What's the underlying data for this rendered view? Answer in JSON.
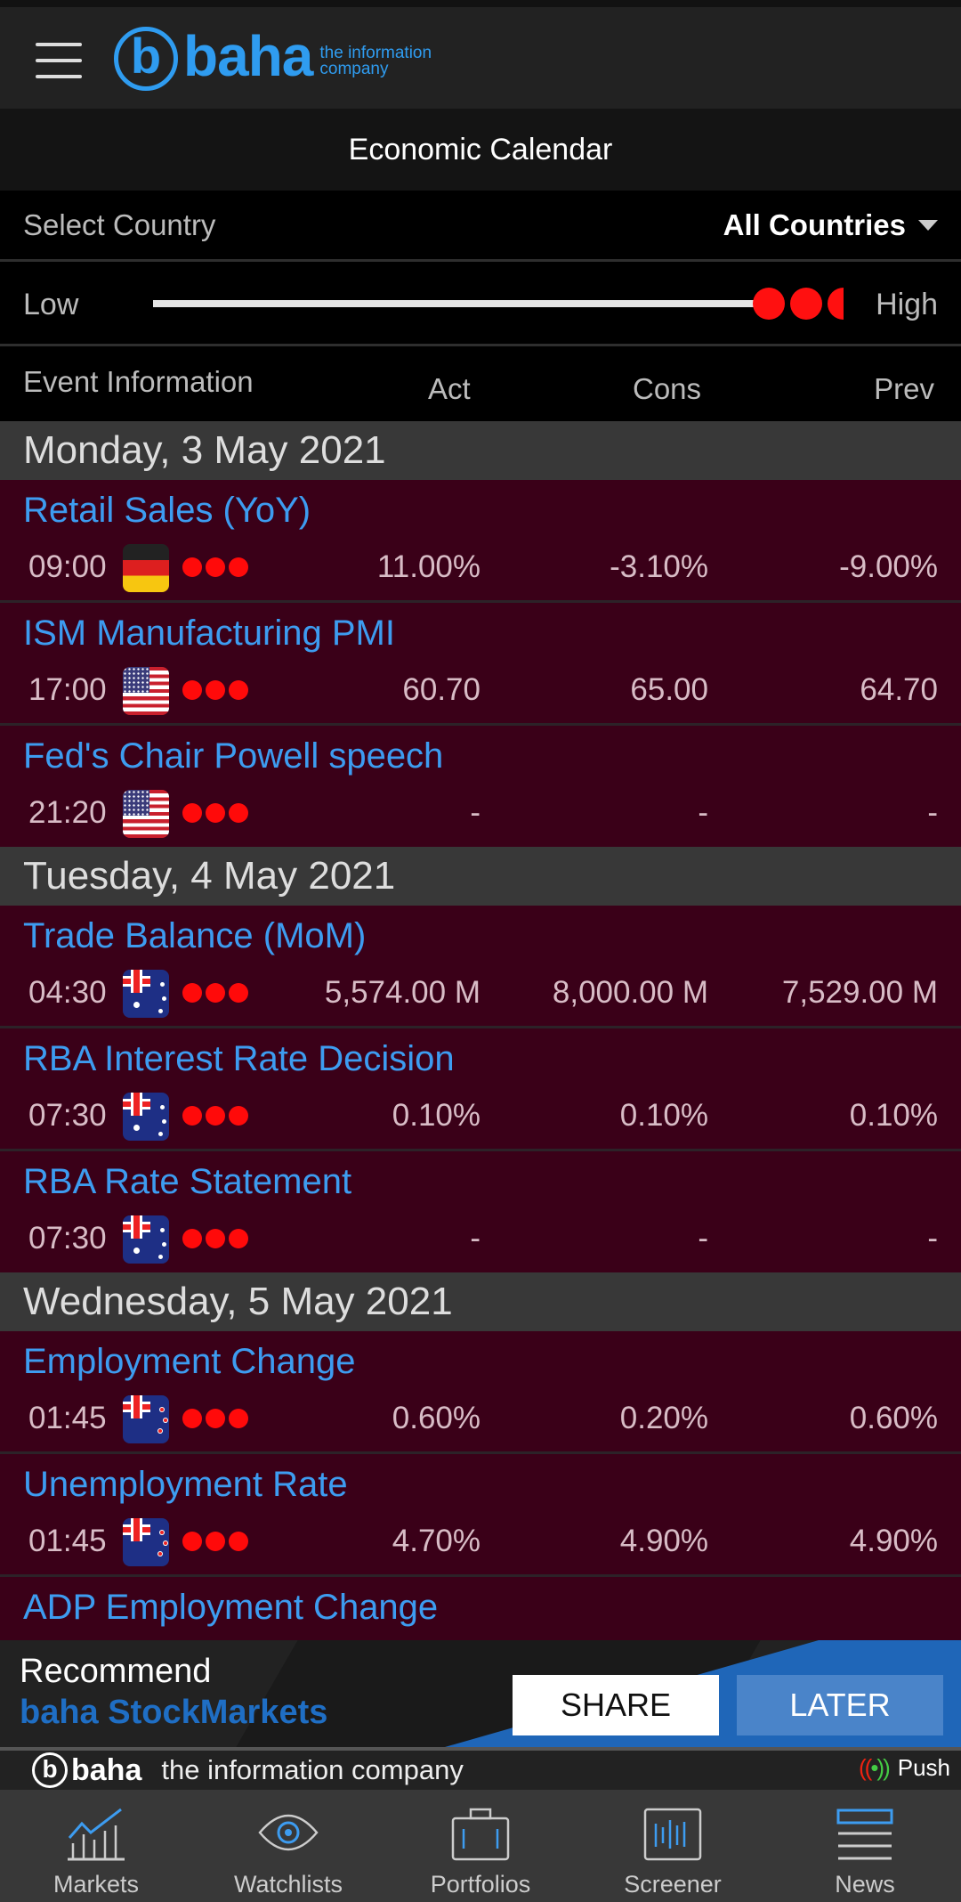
{
  "app": {
    "brand": "baha",
    "tagline_line1": "the information",
    "tagline_line2": "company",
    "logo_letter": "b"
  },
  "page_title": "Economic Calendar",
  "country_filter": {
    "label": "Select Country",
    "selected": "All Countries"
  },
  "importance_filter": {
    "low_label": "Low",
    "high_label": "High",
    "selected_level": "High",
    "accent_color": "#ff1010"
  },
  "columns": {
    "event": "Event Information",
    "actual": "Act",
    "consensus": "Cons",
    "previous": "Prev"
  },
  "days": [
    {
      "date": "Monday, 3 May 2021",
      "events": [
        {
          "name": "Retail Sales (YoY)",
          "time": "09:00",
          "country": "Germany",
          "flag": "de",
          "importance": 3,
          "actual": "11.00%",
          "consensus": "-3.10%",
          "previous": "-9.00%"
        },
        {
          "name": "ISM Manufacturing PMI",
          "time": "17:00",
          "country": "United States",
          "flag": "us",
          "importance": 3,
          "actual": "60.70",
          "consensus": "65.00",
          "previous": "64.70"
        },
        {
          "name": "Fed's Chair Powell speech",
          "time": "21:20",
          "country": "United States",
          "flag": "us",
          "importance": 3,
          "actual": "-",
          "consensus": "-",
          "previous": "-"
        }
      ]
    },
    {
      "date": "Tuesday, 4 May 2021",
      "events": [
        {
          "name": "Trade Balance (MoM)",
          "time": "04:30",
          "country": "Australia",
          "flag": "au",
          "importance": 3,
          "actual": "5,574.00 M",
          "consensus": "8,000.00 M",
          "previous": "7,529.00 M"
        },
        {
          "name": "RBA Interest Rate Decision",
          "time": "07:30",
          "country": "Australia",
          "flag": "au",
          "importance": 3,
          "actual": "0.10%",
          "consensus": "0.10%",
          "previous": "0.10%"
        },
        {
          "name": "RBA Rate Statement",
          "time": "07:30",
          "country": "Australia",
          "flag": "au",
          "importance": 3,
          "actual": "-",
          "consensus": "-",
          "previous": "-"
        }
      ]
    },
    {
      "date": "Wednesday, 5 May 2021",
      "events": [
        {
          "name": "Employment Change",
          "time": "01:45",
          "country": "New Zealand",
          "flag": "nz",
          "importance": 3,
          "actual": "0.60%",
          "consensus": "0.20%",
          "previous": "0.60%"
        },
        {
          "name": "Unemployment Rate",
          "time": "01:45",
          "country": "New Zealand",
          "flag": "nz",
          "importance": 3,
          "actual": "4.70%",
          "consensus": "4.90%",
          "previous": "4.90%"
        },
        {
          "name": "ADP Employment Change"
        }
      ]
    }
  ],
  "banner": {
    "line1": "Recommend",
    "line2": "baha StockMarkets",
    "share_label": "SHARE",
    "later_label": "LATER"
  },
  "footer": {
    "brand": "baha",
    "tagline": "the information company",
    "push_label": "Push"
  },
  "tabs": [
    {
      "label": "Markets",
      "icon": "chart-icon"
    },
    {
      "label": "Watchlists",
      "icon": "eye-icon"
    },
    {
      "label": "Portfolios",
      "icon": "briefcase-icon"
    },
    {
      "label": "Screener",
      "icon": "screener-icon"
    },
    {
      "label": "News",
      "icon": "news-icon"
    }
  ],
  "colors": {
    "brand_blue": "#2f9cf0",
    "event_bg": "#3a0018",
    "event_name": "#3d9cf0",
    "importance_dot": "#ff0a0a"
  }
}
